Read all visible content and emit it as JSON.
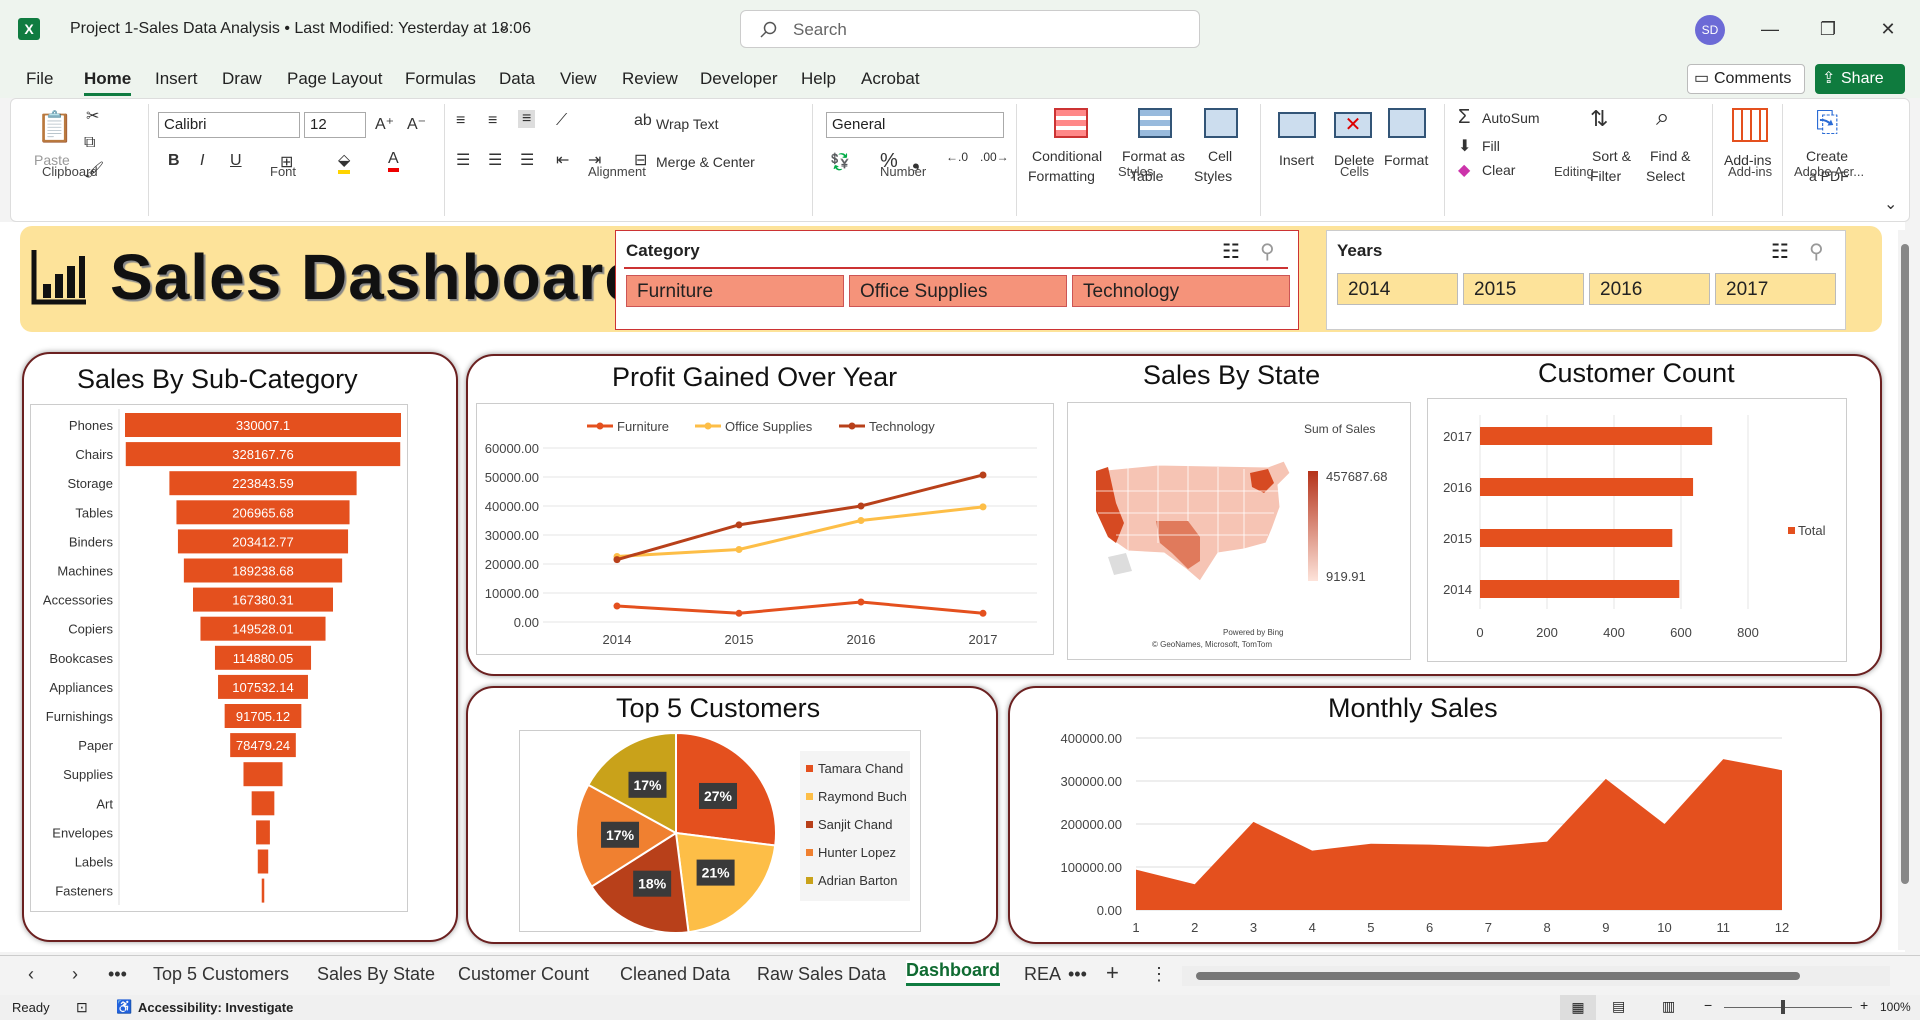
{
  "window": {
    "title": "Project 1-Sales Data Analysis  •  Last Modified: Yesterday at 18:06",
    "search_placeholder": "Search",
    "user_initials": "SD",
    "minimize": "—",
    "restore": "❐",
    "close": "✕"
  },
  "menu": {
    "items": [
      "File",
      "Home",
      "Insert",
      "Draw",
      "Page Layout",
      "Formulas",
      "Data",
      "View",
      "Review",
      "Developer",
      "Help",
      "Acrobat"
    ],
    "comments": "Comments",
    "share": "Share"
  },
  "ribbon": {
    "clipboard": {
      "paste": "Paste",
      "group": "Clipboard"
    },
    "font": {
      "name": "Calibri",
      "size": "12",
      "group": "Font"
    },
    "alignment": {
      "wrap": "Wrap Text",
      "merge": "Merge & Center",
      "group": "Alignment"
    },
    "number": {
      "format": "General",
      "group": "Number"
    },
    "styles": {
      "cond1": "Conditional",
      "cond2": "Formatting",
      "fmt1": "Format as",
      "fmt2": "Table",
      "cell1": "Cell",
      "cell2": "Styles",
      "group": "Styles"
    },
    "cells": {
      "insert": "Insert",
      "delete": "Delete",
      "format": "Format",
      "group": "Cells"
    },
    "editing": {
      "autosum": "AutoSum",
      "fill": "Fill",
      "clear": "Clear",
      "sort1": "Sort &",
      "sort2": "Filter",
      "find1": "Find &",
      "find2": "Select",
      "group": "Editing"
    },
    "addins": {
      "label": "Add-ins",
      "group": "Add-ins"
    },
    "adobe": {
      "l1": "Create",
      "l2": "a PDF",
      "group": "Adobe Acr..."
    }
  },
  "dashboard": {
    "title": "Sales Dashboard",
    "category_slicer": {
      "title": "Category",
      "items": [
        "Furniture",
        "Office Supplies",
        "Technology"
      ]
    },
    "years_slicer": {
      "title": "Years",
      "items": [
        "2014",
        "2015",
        "2016",
        "2017"
      ]
    }
  },
  "colors": {
    "orange": "#e4501e",
    "yellow": "#fdbe47",
    "darkred": "#b8401a",
    "gold": "#c9a21a",
    "banner": "#fde39a",
    "border": "#6b2020"
  },
  "chart_data": [
    {
      "id": "subcat",
      "type": "bar",
      "title": "Sales By Sub-Category",
      "categories": [
        "Phones",
        "Chairs",
        "Storage",
        "Tables",
        "Binders",
        "Machines",
        "Accessories",
        "Copiers",
        "Bookcases",
        "Appliances",
        "Furnishings",
        "Paper",
        "Supplies",
        "Art",
        "Envelopes",
        "Labels",
        "Fasteners"
      ],
      "values": [
        330007.1,
        328167.76,
        223843.59,
        206965.68,
        203412.77,
        189238.68,
        167380.31,
        149528.01,
        114880.05,
        107532.14,
        91705.12,
        78479.24,
        46673.54,
        27118.79,
        16476.4,
        12486.31,
        3024.28
      ],
      "labels": [
        "330007.1",
        "328167.76",
        "223843.59",
        "206965.68",
        "203412.77",
        "189238.68",
        "167380.31",
        "149528.01",
        "114880.05",
        "107532.14",
        "91705.12",
        "78479.24",
        "",
        "",
        "",
        "",
        ""
      ]
    },
    {
      "id": "profit",
      "type": "line",
      "title": "Profit Gained Over Year",
      "x": [
        "2014",
        "2015",
        "2016",
        "2017"
      ],
      "yticks": [
        "60000.00",
        "50000.00",
        "40000.00",
        "30000.00",
        "20000.00",
        "10000.00",
        "0.00"
      ],
      "ylim": [
        0,
        60000
      ],
      "series": [
        {
          "name": "Furniture",
          "values": [
            5500,
            3000,
            6900,
            3000
          ]
        },
        {
          "name": "Office Supplies",
          "values": [
            22600,
            25000,
            35000,
            39700
          ]
        },
        {
          "name": "Technology",
          "values": [
            21500,
            33500,
            40000,
            50700
          ]
        }
      ]
    },
    {
      "id": "state",
      "type": "map",
      "title": "Sales By State",
      "legend_title": "Sum of Sales",
      "max_label": "457687.68",
      "min_label": "919.91",
      "credit1": "Powered by Bing",
      "credit2": "© GeoNames, Microsoft, TomTom"
    },
    {
      "id": "customers",
      "type": "bar",
      "title": "Customer Count",
      "categories": [
        "2017",
        "2016",
        "2015",
        "2014"
      ],
      "values": [
        693,
        636,
        574,
        595
      ],
      "xticks": [
        "0",
        "200",
        "400",
        "600",
        "800"
      ],
      "xlim": [
        0,
        800
      ],
      "legend": "Total"
    },
    {
      "id": "top5",
      "type": "pie",
      "title": "Top 5 Customers",
      "labels": [
        "Tamara Chand",
        "Raymond Buch",
        "Sanjit Chand",
        "Hunter Lopez",
        "Adrian Barton"
      ],
      "values": [
        27,
        21,
        18,
        17,
        17
      ],
      "pct": [
        "27%",
        "21%",
        "18%",
        "17%",
        "17%"
      ]
    },
    {
      "id": "monthly",
      "type": "area",
      "title": "Monthly Sales",
      "x": [
        "1",
        "2",
        "3",
        "4",
        "5",
        "6",
        "7",
        "8",
        "9",
        "10",
        "11",
        "12"
      ],
      "values": [
        94000,
        60000,
        205000,
        138000,
        154000,
        152000,
        147000,
        159000,
        305000,
        200000,
        351000,
        325000
      ],
      "yticks": [
        "400000.00",
        "300000.00",
        "200000.00",
        "100000.00",
        "0.00"
      ],
      "ylim": [
        0,
        400000
      ]
    }
  ],
  "tabs": {
    "items": [
      "Top 5 Customers",
      "Sales By State",
      "Customer Count",
      "Cleaned Data",
      "Raw Sales Data",
      "Dashboard",
      "REA"
    ],
    "active": "Dashboard"
  },
  "status": {
    "ready": "Ready",
    "accessibility": "Accessibility: Investigate",
    "zoom": "100%"
  }
}
